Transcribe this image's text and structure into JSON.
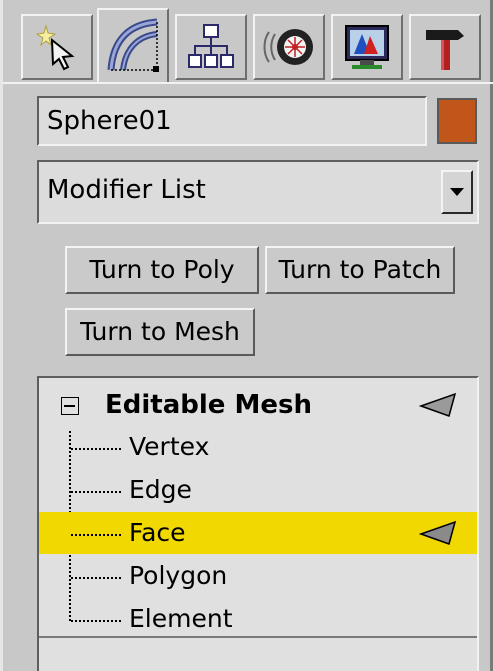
{
  "tabs": [
    {
      "name": "create-tab",
      "icon": "create-star-cursor-icon",
      "active": false
    },
    {
      "name": "modify-tab",
      "icon": "modify-curve-icon",
      "active": true
    },
    {
      "name": "hierarchy-tab",
      "icon": "hierarchy-icon",
      "active": false
    },
    {
      "name": "motion-tab",
      "icon": "motion-wheel-icon",
      "active": false
    },
    {
      "name": "display-tab",
      "icon": "display-monitor-icon",
      "active": false
    },
    {
      "name": "utilities-tab",
      "icon": "utilities-hammer-icon",
      "active": false
    }
  ],
  "object": {
    "name": "Sphere01",
    "color": "#c0561a"
  },
  "modifier_list": {
    "label": "Modifier List"
  },
  "buttons": {
    "turn_to_poly": "Turn to Poly",
    "turn_to_patch": "Turn to Patch",
    "turn_to_mesh": "Turn to Mesh"
  },
  "stack": {
    "root": "Editable Mesh",
    "items": [
      "Vertex",
      "Edge",
      "Face",
      "Polygon",
      "Element"
    ],
    "selected": "Face",
    "highlight_color": "#f0d800"
  }
}
